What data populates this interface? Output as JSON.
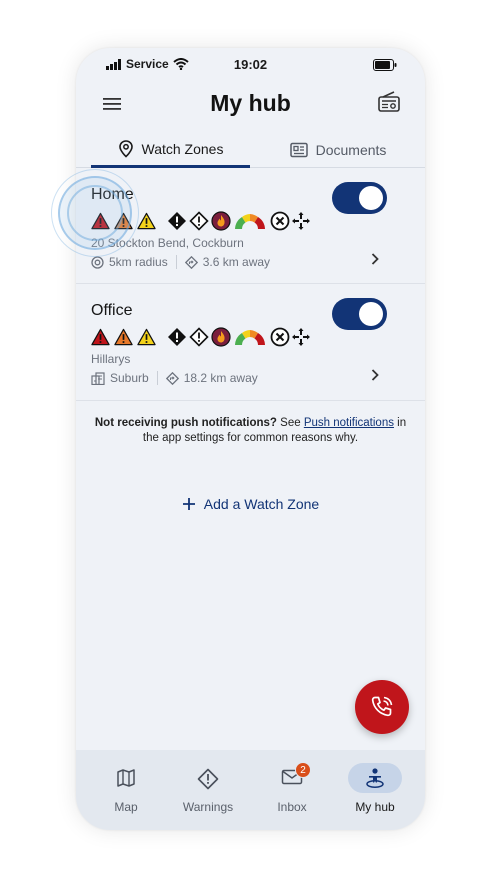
{
  "status_bar": {
    "carrier": "Service",
    "time": "19:02"
  },
  "header": {
    "title": "My hub",
    "menu_icon": "hamburger-menu-icon",
    "right_icon": "radio-icon"
  },
  "tabs": [
    {
      "label": "Watch Zones",
      "icon": "location-pin-icon",
      "active": true
    },
    {
      "label": "Documents",
      "icon": "document-icon",
      "active": false
    }
  ],
  "zones": [
    {
      "name": "Home",
      "address": "20 Stockton Bend, Cockburn",
      "meta1": "5km radius",
      "meta2": "3.6 km away",
      "enabled": true
    },
    {
      "name": "Office",
      "address": "Hillarys",
      "meta1": "Suburb",
      "meta2": "18.2 km away",
      "enabled": true
    }
  ],
  "notice": {
    "lead": "Not receiving push notifications?",
    "see": " See ",
    "link": "Push notifications",
    "tail": " in the app settings for common reasons why."
  },
  "add_zone_label": "Add a Watch Zone",
  "nav": {
    "items": [
      {
        "label": "Map",
        "icon": "map-icon"
      },
      {
        "label": "Warnings",
        "icon": "warning-icon"
      },
      {
        "label": "Inbox",
        "icon": "mail-icon",
        "badge": "2"
      },
      {
        "label": "My hub",
        "icon": "person-hub-icon",
        "active": true
      }
    ]
  },
  "colors": {
    "brand": "#123476",
    "emergency": "#c0151b",
    "background": "#eff2f7"
  }
}
